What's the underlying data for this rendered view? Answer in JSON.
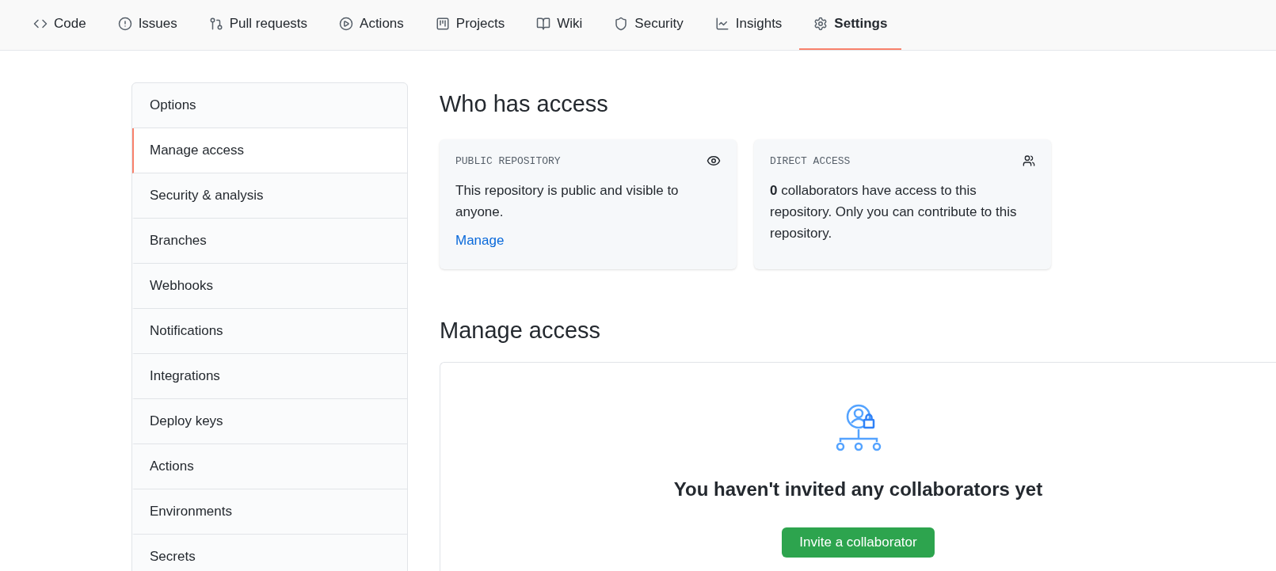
{
  "tabs": [
    {
      "label": "Code",
      "kind": "code",
      "selected": false
    },
    {
      "label": "Issues",
      "kind": "issue",
      "selected": false
    },
    {
      "label": "Pull requests",
      "kind": "pull",
      "selected": false
    },
    {
      "label": "Actions",
      "kind": "play",
      "selected": false
    },
    {
      "label": "Projects",
      "kind": "project",
      "selected": false
    },
    {
      "label": "Wiki",
      "kind": "book",
      "selected": false
    },
    {
      "label": "Security",
      "kind": "shield",
      "selected": false
    },
    {
      "label": "Insights",
      "kind": "graph",
      "selected": false
    },
    {
      "label": "Settings",
      "kind": "gear",
      "selected": true
    }
  ],
  "sidebar": {
    "items": [
      {
        "label": "Options",
        "selected": false
      },
      {
        "label": "Manage access",
        "selected": true
      },
      {
        "label": "Security & analysis",
        "selected": false
      },
      {
        "label": "Branches",
        "selected": false
      },
      {
        "label": "Webhooks",
        "selected": false
      },
      {
        "label": "Notifications",
        "selected": false
      },
      {
        "label": "Integrations",
        "selected": false
      },
      {
        "label": "Deploy keys",
        "selected": false
      },
      {
        "label": "Actions",
        "selected": false
      },
      {
        "label": "Environments",
        "selected": false
      },
      {
        "label": "Secrets",
        "selected": false
      }
    ]
  },
  "who_has_access": {
    "title": "Who has access",
    "cards": [
      {
        "kind": "public",
        "heading": "PUBLIC REPOSITORY",
        "text": "This repository is public and visible to anyone.",
        "link": "Manage"
      },
      {
        "kind": "direct",
        "heading": "DIRECT ACCESS",
        "text": "**0** collaborators have access to this repository. Only you can contribute to this repository."
      }
    ]
  },
  "manage_access": {
    "title": "Manage access",
    "empty_message": "You haven't invited any collaborators yet",
    "button": "Invite a collaborator"
  }
}
